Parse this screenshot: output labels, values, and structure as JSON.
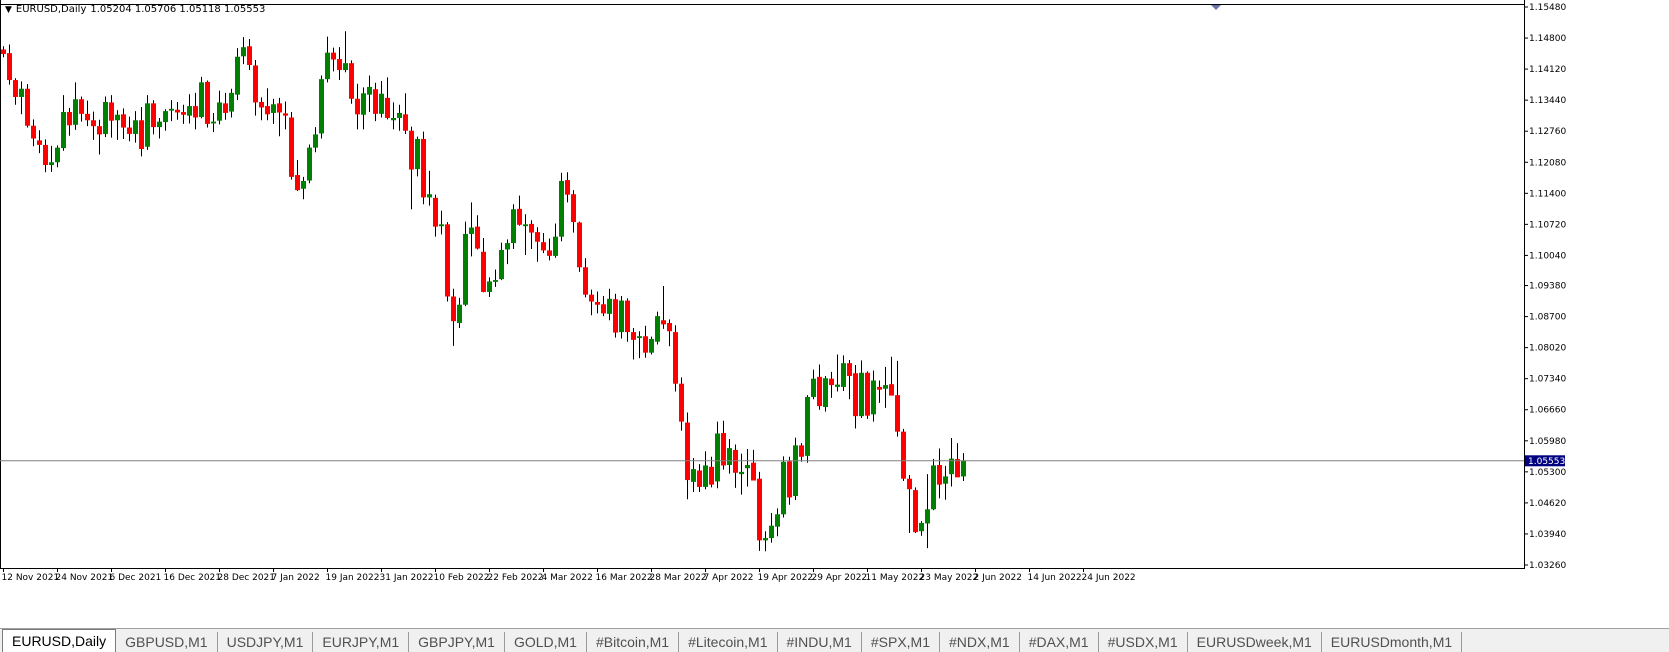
{
  "header": {
    "symbol": "EURUSD,Daily",
    "ohlc": "1.05204 1.05706 1.05118 1.05553"
  },
  "current_price_label": "1.05553",
  "tabs": [
    {
      "label": "EURUSD,Daily",
      "active": true
    },
    {
      "label": "GBPUSD,M1"
    },
    {
      "label": "USDJPY,M1"
    },
    {
      "label": "EURJPY,M1"
    },
    {
      "label": "GBPJPY,M1"
    },
    {
      "label": "GOLD,M1"
    },
    {
      "label": "#Bitcoin,M1"
    },
    {
      "label": "#Litecoin,M1"
    },
    {
      "label": "#INDU,M1"
    },
    {
      "label": "#SPX,M1"
    },
    {
      "label": "#NDX,M1"
    },
    {
      "label": "#DAX,M1"
    },
    {
      "label": "#USDX,M1"
    },
    {
      "label": "EURUSDweek,M1"
    },
    {
      "label": "EURUSDmonth,M1"
    }
  ],
  "colors": {
    "bull": "#008000",
    "bear": "#ff0000",
    "wick": "#000000",
    "price_line": "#808080",
    "price_label_bg": "#000080"
  },
  "chart_data": {
    "type": "candlestick",
    "title": "EURUSD,Daily",
    "ylim": [
      1.0326,
      1.1548
    ],
    "y_ticks": [
      "1.15480",
      "1.14800",
      "1.14120",
      "1.13440",
      "1.12760",
      "1.12080",
      "1.11400",
      "1.10720",
      "1.10040",
      "1.09380",
      "1.08700",
      "1.08020",
      "1.07340",
      "1.06660",
      "1.05980",
      "1.05300",
      "1.04620",
      "1.03940",
      "1.03260"
    ],
    "x_ticks": [
      "12 Nov 2021",
      "24 Nov 2021",
      "6 Dec 2021",
      "16 Dec 2021",
      "28 Dec 2021",
      "7 Jan 2022",
      "19 Jan 2022",
      "31 Jan 2022",
      "10 Feb 2022",
      "22 Feb 2022",
      "4 Mar 2022",
      "16 Mar 2022",
      "28 Mar 2022",
      "7 Apr 2022",
      "19 Apr 2022",
      "29 Apr 2022",
      "11 May 2022",
      "23 May 2022",
      "2 Jun 2022",
      "14 Jun 2022",
      "24 Jun 2022"
    ],
    "current_price": 1.05553,
    "candles": [
      [
        1.1455,
        1.1462,
        1.1438,
        1.1445
      ],
      [
        1.1447,
        1.1466,
        1.1378,
        1.1388
      ],
      [
        1.1388,
        1.1392,
        1.1334,
        1.1351
      ],
      [
        1.1351,
        1.1385,
        1.1313,
        1.1369
      ],
      [
        1.1369,
        1.1379,
        1.1284,
        1.1288
      ],
      [
        1.1288,
        1.1302,
        1.1243,
        1.126
      ],
      [
        1.1256,
        1.1278,
        1.1228,
        1.1246
      ],
      [
        1.1246,
        1.1258,
        1.1186,
        1.1202
      ],
      [
        1.1202,
        1.1244,
        1.1187,
        1.1208
      ],
      [
        1.1208,
        1.1245,
        1.1197,
        1.124
      ],
      [
        1.1239,
        1.1355,
        1.1233,
        1.1318
      ],
      [
        1.1318,
        1.1327,
        1.1266,
        1.1289
      ],
      [
        1.129,
        1.1383,
        1.1279,
        1.1346
      ],
      [
        1.1346,
        1.1352,
        1.1297,
        1.1314
      ],
      [
        1.1314,
        1.1343,
        1.1287,
        1.13
      ],
      [
        1.13,
        1.1319,
        1.1257,
        1.1287
      ],
      [
        1.1287,
        1.1301,
        1.1225,
        1.1269
      ],
      [
        1.127,
        1.1352,
        1.1263,
        1.134
      ],
      [
        1.1339,
        1.1355,
        1.1262,
        1.1299
      ],
      [
        1.13,
        1.1322,
        1.1257,
        1.1312
      ],
      [
        1.1313,
        1.1326,
        1.1259,
        1.1284
      ],
      [
        1.1284,
        1.1308,
        1.1254,
        1.127
      ],
      [
        1.127,
        1.132,
        1.1251,
        1.13
      ],
      [
        1.13,
        1.1329,
        1.1221,
        1.1237
      ],
      [
        1.1242,
        1.1355,
        1.1235,
        1.1337
      ],
      [
        1.1337,
        1.1344,
        1.1269,
        1.1285
      ],
      [
        1.1285,
        1.1305,
        1.126,
        1.1297
      ],
      [
        1.1296,
        1.1324,
        1.1277,
        1.132
      ],
      [
        1.1321,
        1.1344,
        1.1298,
        1.1325
      ],
      [
        1.1323,
        1.134,
        1.1301,
        1.1317
      ],
      [
        1.1318,
        1.1334,
        1.1292,
        1.1312
      ],
      [
        1.131,
        1.1357,
        1.1293,
        1.1331
      ],
      [
        1.1331,
        1.136,
        1.128,
        1.1306
      ],
      [
        1.1307,
        1.1395,
        1.1304,
        1.1383
      ],
      [
        1.1384,
        1.1387,
        1.1284,
        1.1292
      ],
      [
        1.1293,
        1.1316,
        1.1274,
        1.1297
      ],
      [
        1.1299,
        1.1365,
        1.1291,
        1.1339
      ],
      [
        1.1337,
        1.136,
        1.1301,
        1.1316
      ],
      [
        1.1319,
        1.1369,
        1.1306,
        1.136
      ],
      [
        1.1356,
        1.1458,
        1.1344,
        1.1439
      ],
      [
        1.144,
        1.1482,
        1.1423,
        1.146
      ],
      [
        1.1462,
        1.1478,
        1.141,
        1.1421
      ],
      [
        1.142,
        1.1432,
        1.131,
        1.1339
      ],
      [
        1.134,
        1.135,
        1.13,
        1.1328
      ],
      [
        1.1331,
        1.137,
        1.13,
        1.1313
      ],
      [
        1.1316,
        1.1347,
        1.1292,
        1.1335
      ],
      [
        1.1337,
        1.1349,
        1.1265,
        1.1317
      ],
      [
        1.1315,
        1.1341,
        1.128,
        1.131
      ],
      [
        1.1306,
        1.1318,
        1.117,
        1.1176
      ],
      [
        1.118,
        1.1213,
        1.1145,
        1.1147
      ],
      [
        1.115,
        1.1176,
        1.1127,
        1.1167
      ],
      [
        1.1168,
        1.1247,
        1.1162,
        1.124
      ],
      [
        1.124,
        1.1285,
        1.123,
        1.1269
      ],
      [
        1.1271,
        1.1398,
        1.126,
        1.139
      ],
      [
        1.139,
        1.1483,
        1.1383,
        1.1448
      ],
      [
        1.1448,
        1.1459,
        1.1407,
        1.1433
      ],
      [
        1.1434,
        1.146,
        1.1388,
        1.141
      ],
      [
        1.141,
        1.1495,
        1.1405,
        1.1425
      ],
      [
        1.1425,
        1.1431,
        1.1336,
        1.1347
      ],
      [
        1.1347,
        1.138,
        1.128,
        1.1313
      ],
      [
        1.1312,
        1.1372,
        1.128,
        1.1359
      ],
      [
        1.1356,
        1.1398,
        1.1318,
        1.1373
      ],
      [
        1.1368,
        1.1382,
        1.1298,
        1.1314
      ],
      [
        1.1314,
        1.1386,
        1.1306,
        1.1358
      ],
      [
        1.1349,
        1.1394,
        1.1302,
        1.1305
      ],
      [
        1.13,
        1.1339,
        1.128,
        1.1305
      ],
      [
        1.1305,
        1.1334,
        1.1277,
        1.1316
      ],
      [
        1.1313,
        1.1359,
        1.127,
        1.1277
      ],
      [
        1.1277,
        1.1286,
        1.1105,
        1.1192
      ],
      [
        1.1193,
        1.1264,
        1.1177,
        1.1259
      ],
      [
        1.1259,
        1.1275,
        1.1116,
        1.1131
      ],
      [
        1.1131,
        1.1189,
        1.1113,
        1.1138
      ],
      [
        1.113,
        1.1137,
        1.1045,
        1.1067
      ],
      [
        1.1068,
        1.1102,
        1.105,
        1.1072
      ],
      [
        1.1072,
        1.1077,
        1.0903,
        1.0914
      ],
      [
        1.0914,
        1.0931,
        1.0806,
        1.086
      ],
      [
        1.0856,
        1.0911,
        1.0845,
        1.0896
      ],
      [
        1.0896,
        1.1078,
        1.0893,
        1.1051
      ],
      [
        1.1051,
        1.112,
        1.1002,
        1.1065
      ],
      [
        1.1067,
        1.1092,
        1.1017,
        1.1019
      ],
      [
        1.1012,
        1.1042,
        1.0923,
        1.0924
      ],
      [
        1.0924,
        1.0956,
        1.0913,
        1.0947
      ],
      [
        1.0946,
        1.0973,
        1.0935,
        1.095
      ],
      [
        1.0952,
        1.1032,
        1.095,
        1.1016
      ],
      [
        1.1017,
        1.1039,
        1.0985,
        1.1031
      ],
      [
        1.1031,
        1.1116,
        1.1018,
        1.1105
      ],
      [
        1.1106,
        1.1135,
        1.1069,
        1.1071
      ],
      [
        1.1068,
        1.1094,
        1.1005,
        1.1072
      ],
      [
        1.1073,
        1.1081,
        1.1018,
        1.1054
      ],
      [
        1.1055,
        1.1066,
        1.099,
        1.1034
      ],
      [
        1.1033,
        1.1053,
        1.1009,
        1.1015
      ],
      [
        1.1015,
        1.1041,
        1.0993,
        1.1003
      ],
      [
        1.1003,
        1.1074,
        1.0999,
        1.1045
      ],
      [
        1.1045,
        1.1185,
        1.1035,
        1.1167
      ],
      [
        1.1169,
        1.1186,
        1.112,
        1.1137
      ],
      [
        1.1138,
        1.1147,
        1.1054,
        1.1077
      ],
      [
        1.1076,
        1.1078,
        1.0968,
        1.0978
      ],
      [
        1.0978,
        1.0998,
        1.0912,
        1.0918
      ],
      [
        1.0918,
        1.0929,
        1.0873,
        1.0903
      ],
      [
        1.0902,
        1.0925,
        1.0877,
        1.0896
      ],
      [
        1.0897,
        1.0915,
        1.0871,
        1.0877
      ],
      [
        1.0876,
        1.0931,
        1.0862,
        1.0909
      ],
      [
        1.0908,
        1.092,
        1.0824,
        1.0835
      ],
      [
        1.0836,
        1.0915,
        1.0822,
        1.0905
      ],
      [
        1.0905,
        1.091,
        1.0815,
        1.0836
      ],
      [
        1.0836,
        1.0845,
        1.0776,
        1.0819
      ],
      [
        1.0823,
        1.0838,
        1.0779,
        1.0827
      ],
      [
        1.0827,
        1.085,
        1.078,
        1.0791
      ],
      [
        1.0791,
        1.0826,
        1.0787,
        1.0821
      ],
      [
        1.0815,
        1.0881,
        1.0809,
        1.0871
      ],
      [
        1.0862,
        1.0937,
        1.0843,
        1.0853
      ],
      [
        1.0856,
        1.0864,
        1.0805,
        1.0838
      ],
      [
        1.0836,
        1.0851,
        1.0706,
        1.0723
      ],
      [
        1.0723,
        1.0737,
        1.062,
        1.064
      ],
      [
        1.0638,
        1.066,
        1.047,
        1.0512
      ],
      [
        1.0508,
        1.056,
        1.0486,
        1.0536
      ],
      [
        1.0533,
        1.0547,
        1.0486,
        1.0497
      ],
      [
        1.0497,
        1.0575,
        1.0492,
        1.0544
      ],
      [
        1.0541,
        1.0563,
        1.0496,
        1.0502
      ],
      [
        1.0509,
        1.064,
        1.0494,
        1.0614
      ],
      [
        1.0615,
        1.0642,
        1.0535,
        1.0544
      ],
      [
        1.0545,
        1.0602,
        1.0526,
        1.0582
      ],
      [
        1.0578,
        1.059,
        1.0495,
        1.0528
      ],
      [
        1.0525,
        1.057,
        1.048,
        1.053
      ],
      [
        1.0538,
        1.058,
        1.0498,
        1.0545
      ],
      [
        1.055,
        1.0578,
        1.0511,
        1.0511
      ],
      [
        1.0515,
        1.053,
        1.0357,
        1.038
      ],
      [
        1.038,
        1.04,
        1.0356,
        1.0385
      ],
      [
        1.0385,
        1.044,
        1.0375,
        1.0412
      ],
      [
        1.041,
        1.045,
        1.0389,
        1.0437
      ],
      [
        1.0437,
        1.0564,
        1.043,
        1.0552
      ],
      [
        1.0553,
        1.0563,
        1.0458,
        1.0474
      ],
      [
        1.0477,
        1.0605,
        1.0468,
        1.0588
      ],
      [
        1.0588,
        1.0593,
        1.0552,
        1.0563
      ],
      [
        1.0565,
        1.0698,
        1.055,
        1.0694
      ],
      [
        1.0694,
        1.0754,
        1.0689,
        1.0734
      ],
      [
        1.0738,
        1.0765,
        1.0666,
        1.0674
      ],
      [
        1.0672,
        1.074,
        1.0662,
        1.0735
      ],
      [
        1.0734,
        1.0749,
        1.0692,
        1.072
      ],
      [
        1.0716,
        1.0787,
        1.0706,
        1.0721
      ],
      [
        1.0716,
        1.0785,
        1.0707,
        1.0768
      ],
      [
        1.0768,
        1.0775,
        1.0689,
        1.074
      ],
      [
        1.0746,
        1.0764,
        1.0625,
        1.0652
      ],
      [
        1.0652,
        1.0774,
        1.0648,
        1.0747
      ],
      [
        1.0747,
        1.075,
        1.0646,
        1.0653
      ],
      [
        1.0656,
        1.0752,
        1.064,
        1.073
      ],
      [
        1.0716,
        1.073,
        1.0681,
        1.071
      ],
      [
        1.0712,
        1.076,
        1.067,
        1.072
      ],
      [
        1.0722,
        1.0782,
        1.0703,
        1.0697
      ],
      [
        1.0698,
        1.0773,
        1.0607,
        1.0618
      ],
      [
        1.0618,
        1.0624,
        1.051,
        1.0515
      ],
      [
        1.0515,
        1.0523,
        1.0396,
        1.0492
      ],
      [
        1.049,
        1.0496,
        1.0396,
        1.0398
      ],
      [
        1.04,
        1.0422,
        1.039,
        1.0418
      ],
      [
        1.0417,
        1.0525,
        1.0363,
        1.0448
      ],
      [
        1.0448,
        1.0558,
        1.0446,
        1.0544
      ],
      [
        1.0545,
        1.0581,
        1.0472,
        1.0502
      ],
      [
        1.0504,
        1.0543,
        1.0469,
        1.052
      ],
      [
        1.0525,
        1.0604,
        1.0498,
        1.0559
      ],
      [
        1.0558,
        1.0593,
        1.052,
        1.0518
      ],
      [
        1.052,
        1.0571,
        1.051,
        1.0555
      ]
    ]
  }
}
